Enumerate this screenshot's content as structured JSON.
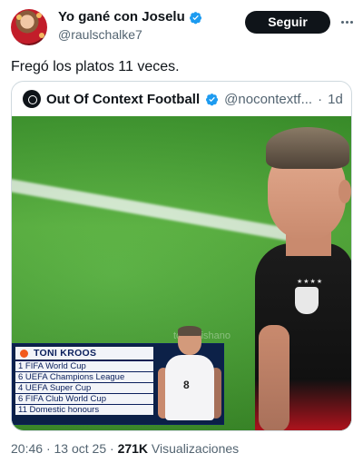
{
  "author": {
    "display_name": "Yo gané con Joselu",
    "handle": "@raulschalke7",
    "verified": true,
    "follow_label": "Seguir"
  },
  "tweet_text": "Fregó los platos 11 veces.",
  "quote": {
    "display_name": "Out Of Context Football",
    "handle": "@nocontextf...",
    "separator": "·",
    "time": "1d",
    "media": {
      "watermark": "totalerishano",
      "overlay": {
        "title": "TONI KROOS",
        "rows": [
          "1 FIFA World Cup",
          "6 UEFA Champions League",
          "4 UEFA Super Cup",
          "6 FIFA Club World Cup",
          "11 Domestic honours"
        ],
        "shirt_number": "8"
      }
    }
  },
  "meta": {
    "time": "20:46",
    "sep1": "·",
    "date": "13 oct 25",
    "sep2": "·",
    "views": "271K",
    "views_label": "Visualizaciones"
  },
  "colors": {
    "verified": "#1d9bf0",
    "follow_bg": "#0f1419",
    "overlay_navy": "#0a1f5c",
    "overlay_accent": "#f25a1d"
  }
}
